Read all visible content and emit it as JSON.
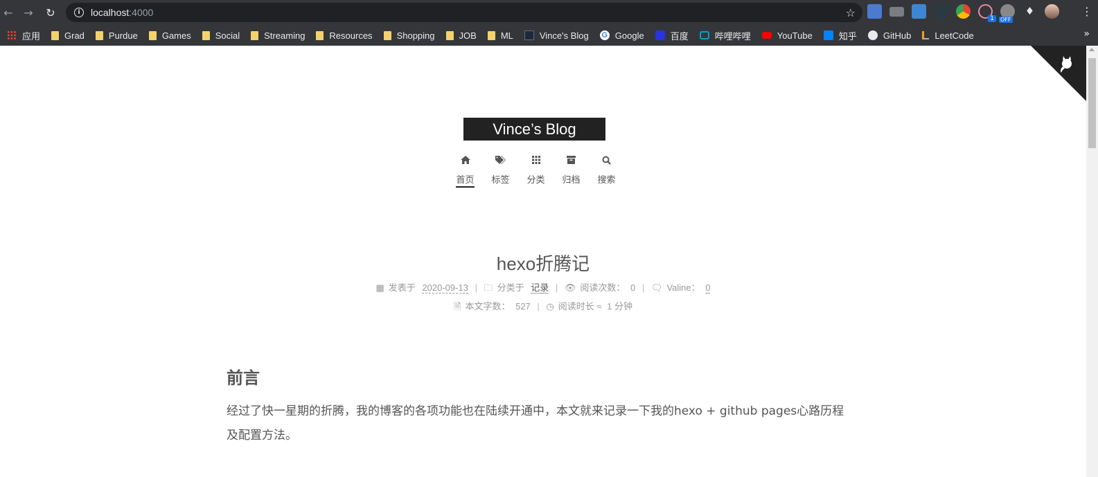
{
  "browser": {
    "url_host": "localhost",
    "url_port": ":4000",
    "ext_badge_count": "1",
    "ext_badge_off": "OFF"
  },
  "bookmarks": [
    {
      "label": "应用",
      "icon": "apps-icon"
    },
    {
      "label": "Grad",
      "icon": "folder-icon"
    },
    {
      "label": "Purdue",
      "icon": "folder-icon"
    },
    {
      "label": "Games",
      "icon": "folder-icon"
    },
    {
      "label": "Social",
      "icon": "folder-icon"
    },
    {
      "label": "Streaming",
      "icon": "folder-icon"
    },
    {
      "label": "Resources",
      "icon": "folder-icon"
    },
    {
      "label": "Shopping",
      "icon": "folder-icon"
    },
    {
      "label": "JOB",
      "icon": "folder-icon"
    },
    {
      "label": "ML",
      "icon": "folder-icon"
    },
    {
      "label": "Vince's Blog",
      "icon": "blog-favicon"
    },
    {
      "label": "Google",
      "icon": "google-icon"
    },
    {
      "label": "百度",
      "icon": "baidu-icon"
    },
    {
      "label": "哔哩哔哩",
      "icon": "bilibili-icon"
    },
    {
      "label": "YouTube",
      "icon": "youtube-icon"
    },
    {
      "label": "知乎",
      "icon": "zhihu-icon"
    },
    {
      "label": "GitHub",
      "icon": "github-icon"
    },
    {
      "label": "LeetCode",
      "icon": "leetcode-icon"
    }
  ],
  "site": {
    "brand": "Vince’s Blog",
    "menu": [
      {
        "label": "首页",
        "icon": "home-icon",
        "active": true
      },
      {
        "label": "标签",
        "icon": "tags-icon"
      },
      {
        "label": "分类",
        "icon": "grid-icon"
      },
      {
        "label": "归档",
        "icon": "archive-icon"
      },
      {
        "label": "搜索",
        "icon": "search-icon"
      }
    ]
  },
  "post": {
    "title": "hexo折腾记",
    "posted_label": "发表于",
    "posted_date": "2020-09-13",
    "category_label": "分类于",
    "category": "记录",
    "views_label": "阅读次数：",
    "views": "0",
    "valine_label": "Valine：",
    "valine_count": "0",
    "wordcount_label": "本文字数：",
    "wordcount": "527",
    "readtime_label": "阅读时长 ≈",
    "readtime": "1 分钟",
    "heading": "前言",
    "paragraph": "经过了快一星期的折腾，我的博客的各项功能也在陆续开通中，本文就来记录一下我的hexo + github pages心路历程及配置方法。"
  },
  "colors": {
    "chrome_bg": "#35363a",
    "omnibox_bg": "#202124",
    "brand_bg": "#222222",
    "text": "#555555",
    "meta": "#999999"
  }
}
